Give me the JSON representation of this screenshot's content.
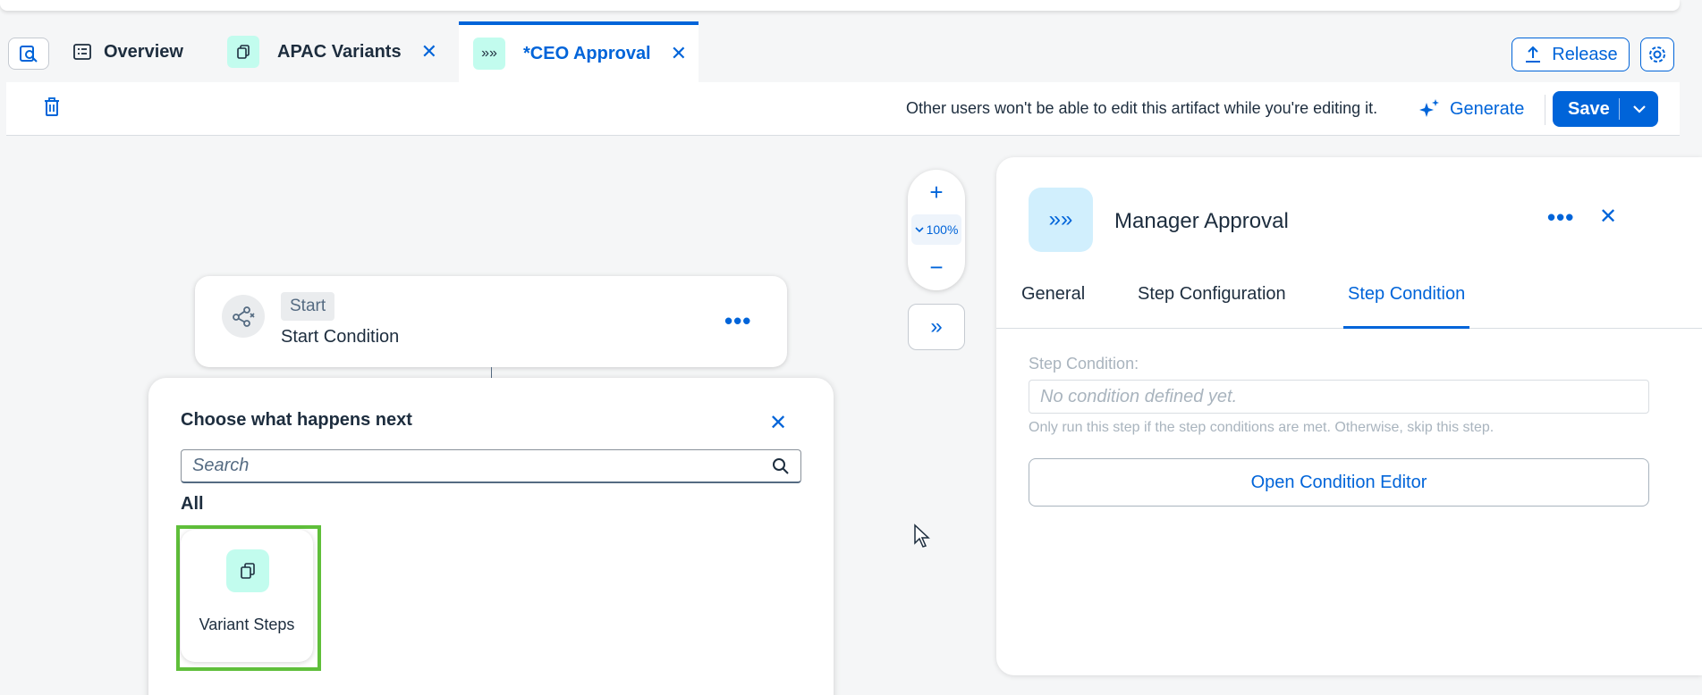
{
  "tabs": {
    "search_icon": "search-doc-icon",
    "overview": {
      "label": "Overview",
      "icon": "list-icon"
    },
    "apac": {
      "label": "APAC Variants",
      "icon": "copy-icon"
    },
    "ceo": {
      "label": "*CEO Approval",
      "icon": "process-icon",
      "active": true
    }
  },
  "header": {
    "release_label": "Release",
    "settings_icon": "gear-icon"
  },
  "toolbar": {
    "lock_message": "Other users won't be able to edit this artifact while you're editing it.",
    "generate_label": "Generate",
    "save_label": "Save"
  },
  "canvas": {
    "start_node": {
      "badge": "Start",
      "title": "Start Condition",
      "more": "•••"
    },
    "zoom": {
      "plus": "+",
      "level": "100%",
      "minus": "−"
    },
    "expand": "»"
  },
  "chooser": {
    "title": "Choose what happens next",
    "search_placeholder": "Search",
    "group_label": "All",
    "items": [
      {
        "label": "Variant Steps",
        "icon": "copy-icon"
      }
    ]
  },
  "panel": {
    "icon_glyph": "»»",
    "title": "Manager Approval",
    "more": "•••",
    "tabs": [
      {
        "label": "General"
      },
      {
        "label": "Step Configuration"
      },
      {
        "label": "Step Condition",
        "active": true
      }
    ],
    "condition_label": "Step Condition:",
    "condition_placeholder": "No condition defined yet.",
    "condition_help": "Only run this step if the step conditions are met. Otherwise, skip this step.",
    "open_editor_label": "Open Condition Editor"
  },
  "colors": {
    "accent": "#0064d9",
    "highlight": "#5fbf3a",
    "mint": "#c2fcee"
  }
}
